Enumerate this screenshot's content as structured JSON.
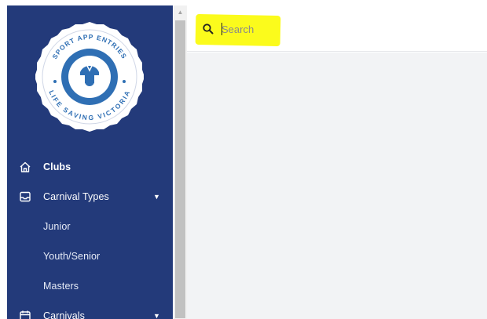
{
  "logo": {
    "ring_top_text": "SPORT APP ENTRIES",
    "ring_bottom_text": "LIFE SAVING VICTORIA"
  },
  "sidebar": {
    "items": [
      {
        "label": "Clubs",
        "icon": "home-icon"
      },
      {
        "label": "Carnival Types",
        "icon": "inbox-icon",
        "caret": "▼"
      },
      {
        "label": "Junior"
      },
      {
        "label": "Youth/Senior"
      },
      {
        "label": "Masters"
      },
      {
        "label": "Carnivals",
        "icon": "calendar-icon",
        "caret": "▼"
      }
    ]
  },
  "search": {
    "placeholder": "Search",
    "value": "",
    "icon": "search-icon"
  },
  "colors": {
    "sidebar_bg": "#233a7a",
    "logo_ring": "#2f6fb4",
    "highlight": "#fbfb1c"
  }
}
